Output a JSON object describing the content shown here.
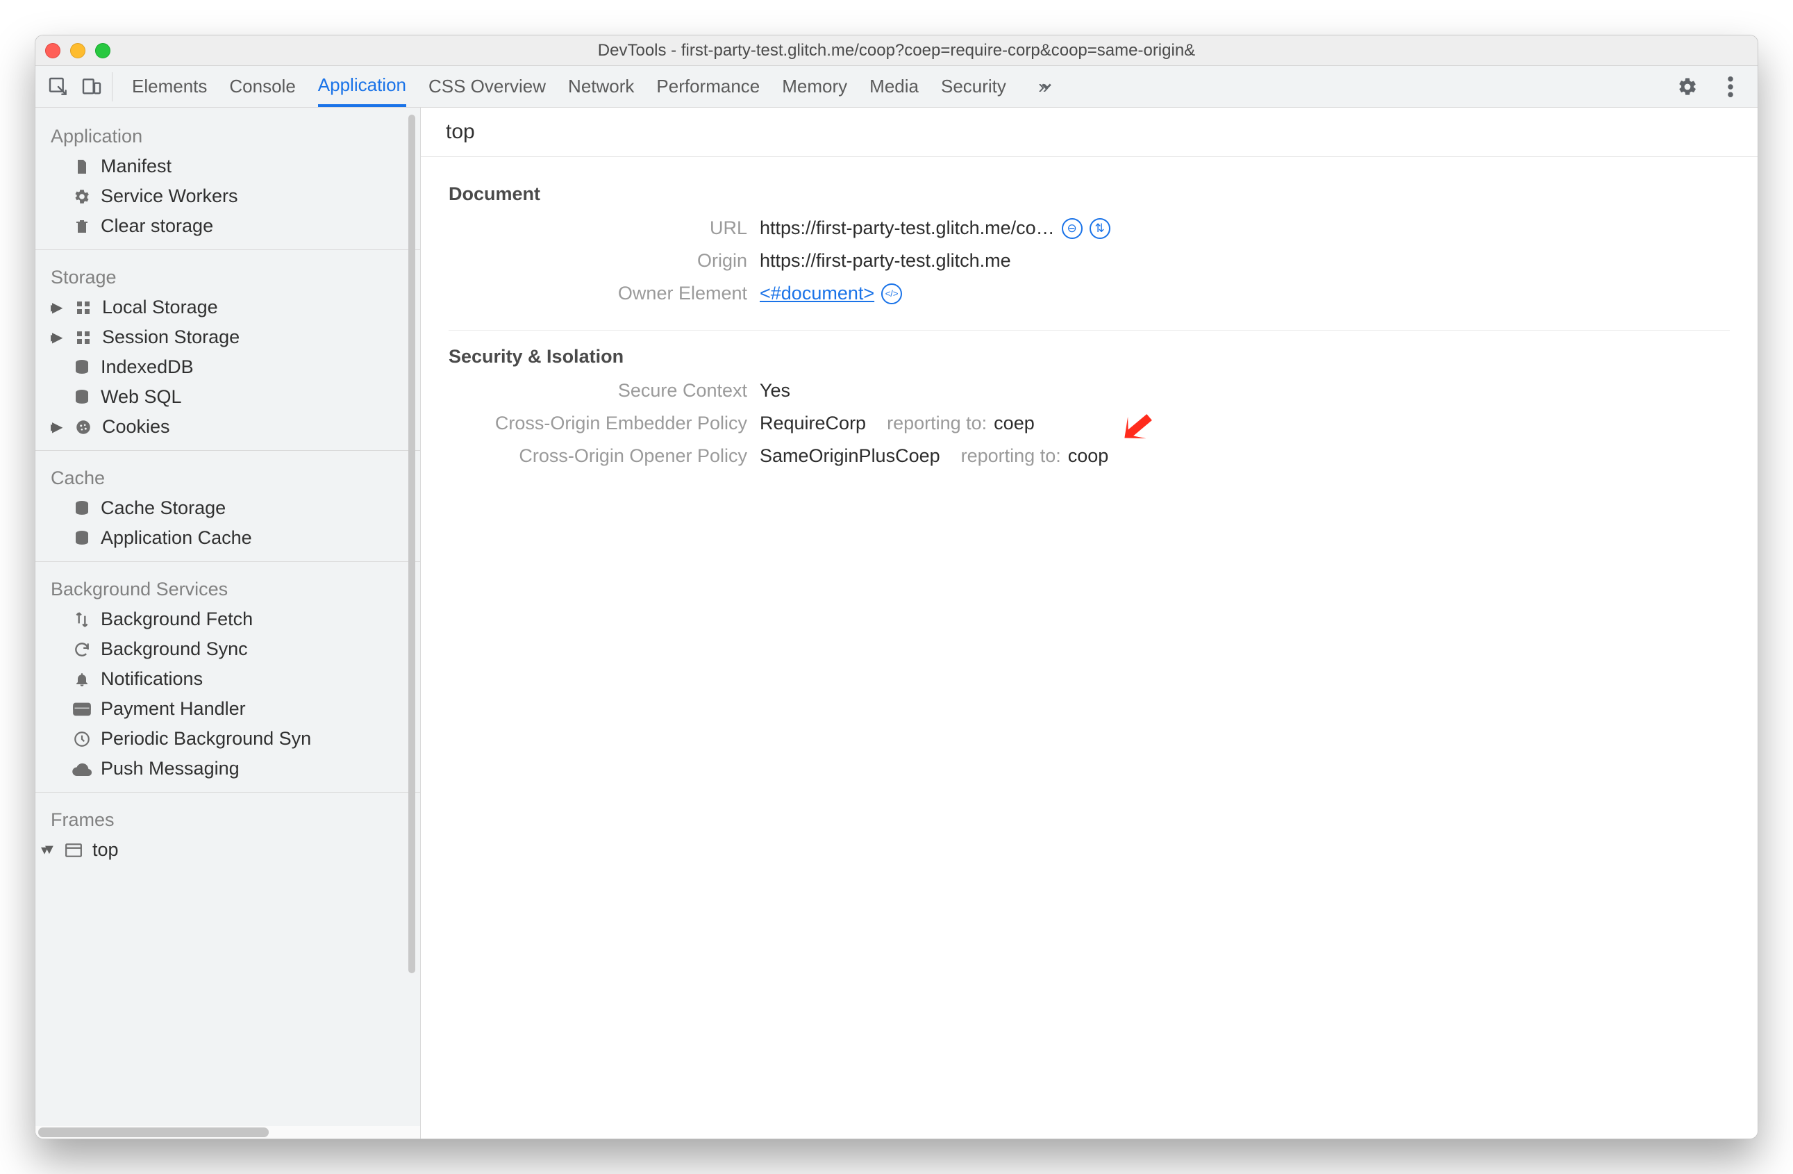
{
  "window_title": "DevTools - first-party-test.glitch.me/coop?coep=require-corp&coop=same-origin&",
  "tabs": [
    "Elements",
    "Console",
    "Application",
    "CSS Overview",
    "Network",
    "Performance",
    "Memory",
    "Media",
    "Security"
  ],
  "active_tab": "Application",
  "sidebar": {
    "groups": [
      {
        "title": "Application",
        "items": [
          {
            "icon": "file",
            "label": "Manifest"
          },
          {
            "icon": "gear",
            "label": "Service Workers"
          },
          {
            "icon": "trash",
            "label": "Clear storage"
          }
        ]
      },
      {
        "title": "Storage",
        "items": [
          {
            "icon": "grid",
            "label": "Local Storage",
            "toggle": true
          },
          {
            "icon": "grid",
            "label": "Session Storage",
            "toggle": true
          },
          {
            "icon": "db",
            "label": "IndexedDB"
          },
          {
            "icon": "db",
            "label": "Web SQL"
          },
          {
            "icon": "cookie",
            "label": "Cookies",
            "toggle": true
          }
        ]
      },
      {
        "title": "Cache",
        "items": [
          {
            "icon": "db",
            "label": "Cache Storage"
          },
          {
            "icon": "db",
            "label": "Application Cache"
          }
        ]
      },
      {
        "title": "Background Services",
        "items": [
          {
            "icon": "updown",
            "label": "Background Fetch"
          },
          {
            "icon": "sync",
            "label": "Background Sync"
          },
          {
            "icon": "bell",
            "label": "Notifications"
          },
          {
            "icon": "card",
            "label": "Payment Handler"
          },
          {
            "icon": "clock",
            "label": "Periodic Background Syn"
          },
          {
            "icon": "cloud",
            "label": "Push Messaging"
          }
        ]
      },
      {
        "title": "Frames",
        "items": [
          {
            "icon": "window",
            "label": "top",
            "toggle": true,
            "open": true
          }
        ]
      }
    ]
  },
  "main": {
    "title": "top",
    "sections": [
      {
        "heading": "Document",
        "rows": [
          {
            "key": "URL",
            "value": "https://first-party-test.glitch.me/co…",
            "extras": [
              "copy",
              "reveal"
            ]
          },
          {
            "key": "Origin",
            "value": "https://first-party-test.glitch.me"
          },
          {
            "key": "Owner Element",
            "link": "<#document>",
            "extras": [
              "code"
            ]
          }
        ]
      },
      {
        "heading": "Security & Isolation",
        "rows": [
          {
            "key": "Secure Context",
            "value": "Yes"
          },
          {
            "key": "Cross-Origin Embedder Policy",
            "value": "RequireCorp",
            "reporting_label": "reporting to:",
            "reporting_target": "coep",
            "annot": true
          },
          {
            "key": "Cross-Origin Opener Policy",
            "value": "SameOriginPlusCoep",
            "reporting_label": "reporting to:",
            "reporting_target": "coop"
          }
        ]
      }
    ]
  }
}
